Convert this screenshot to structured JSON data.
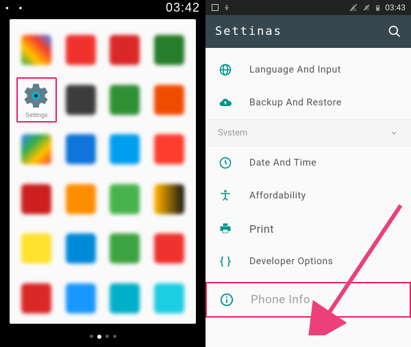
{
  "left_phone": {
    "status_time": "03:42",
    "highlighted_app_label": "Settings"
  },
  "right_phone": {
    "status_time": "03:43",
    "appbar_title": "Settinas",
    "items": {
      "language": "Language And Input",
      "backup": "Backup And Restore",
      "section_system": "Svstem",
      "date_time": "Date And Time",
      "affordability": "Affordability",
      "print": "Print",
      "dev_options": "Developer Options",
      "phone_info": "Phone Info"
    }
  }
}
